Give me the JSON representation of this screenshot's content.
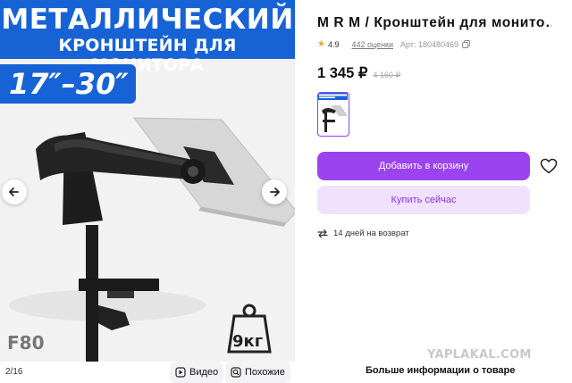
{
  "gallery": {
    "promo": {
      "headline": "МЕТАЛЛИЧЕСКИЙ",
      "subheadline": "КРОНШТЕЙН ДЛЯ МОНИТОРА",
      "size_range": "17″–30″",
      "model_code": "F80",
      "weight": "9кг"
    },
    "counter": "2/16",
    "video_label": "Видео",
    "similar_label": "Похожие",
    "prev_icon": "chevron-left-icon",
    "next_icon": "chevron-right-icon"
  },
  "product": {
    "title": "M R M / Кронштейн для монито…",
    "rating": "4.9",
    "reviews": "442 оценки",
    "article": "Арт: 180480469",
    "price": "1 345 ₽",
    "old_price": "4 160 ₽",
    "add_to_cart": "Добавить в корзину",
    "buy_now": "Купить сейчас",
    "returns": "14 дней на возврат",
    "more_info": "Больше информации о товаре"
  },
  "watermark": "YAPLAKAL.COM",
  "colors": {
    "accent": "#9a43ef",
    "accent_light": "#f0e2fe",
    "banner_blue": "#1763d6",
    "star": "#f5a623"
  }
}
